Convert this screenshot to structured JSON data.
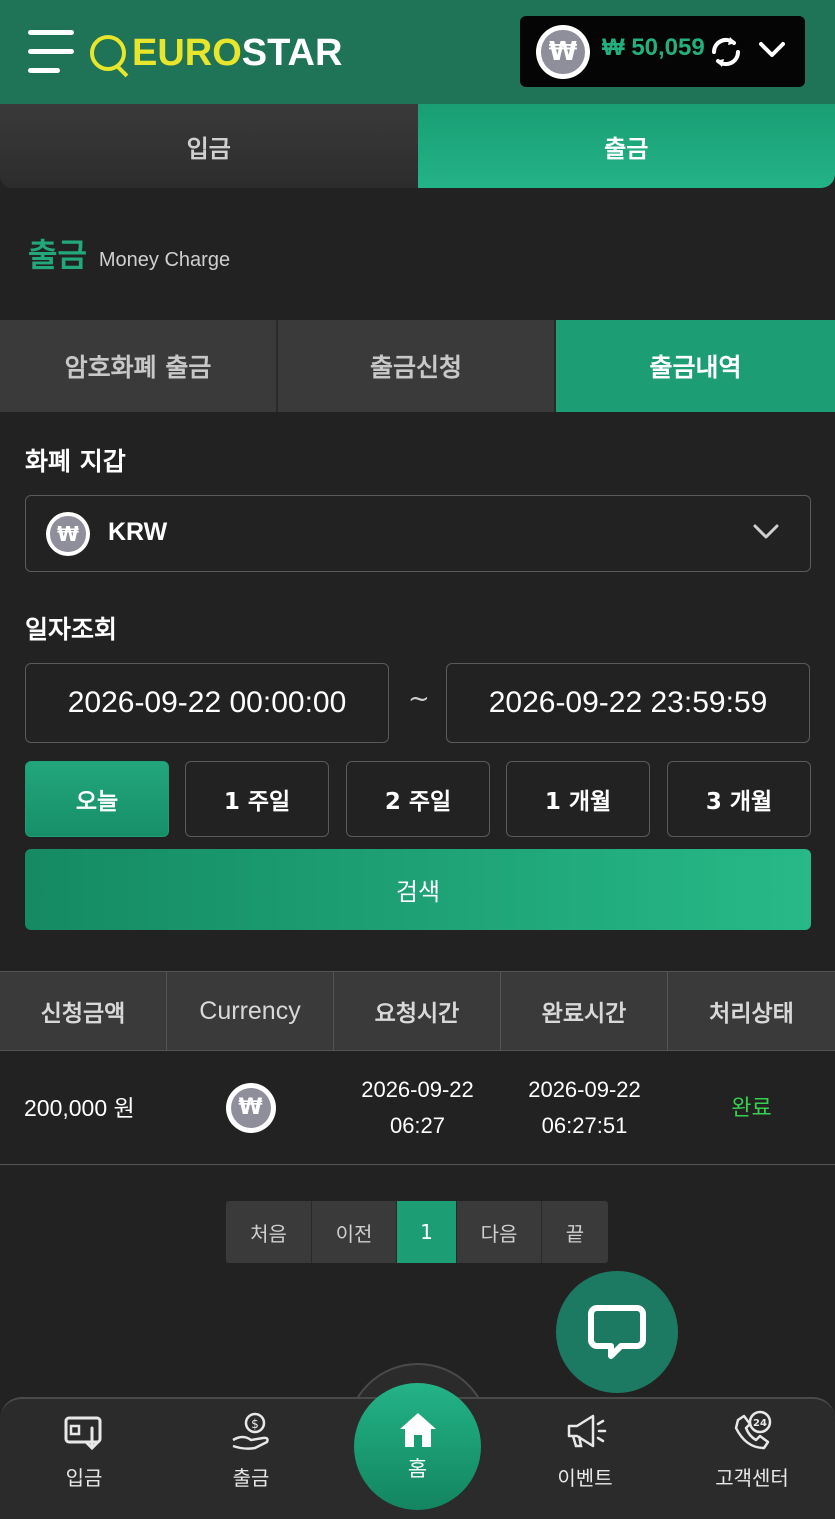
{
  "header": {
    "logo_part1": "EURO",
    "logo_part2": "STAR",
    "currency_symbol": "₩",
    "balance": "₩ 50,059"
  },
  "top_tabs": [
    {
      "label": "입금",
      "active": false
    },
    {
      "label": "출금",
      "active": true
    }
  ],
  "section": {
    "title": "출금",
    "subtitle": "Money Charge"
  },
  "sub_tabs": [
    {
      "label": "암호화폐 출금",
      "active": false
    },
    {
      "label": "출금신청",
      "active": false
    },
    {
      "label": "출금내역",
      "active": true
    }
  ],
  "wallet_select": {
    "label": "화폐 지갑",
    "value": "KRW",
    "icon": "won-coin-icon"
  },
  "date_query": {
    "label": "일자조회",
    "from": "2026-09-22 00:00:00",
    "separator": "~",
    "to": "2026-09-22 23:59:59"
  },
  "quick_ranges": [
    {
      "label": "오늘",
      "active": true
    },
    {
      "label": "1 주일",
      "active": false
    },
    {
      "label": "2 주일",
      "active": false
    },
    {
      "label": "1 개월",
      "active": false
    },
    {
      "label": "3 개월",
      "active": false
    }
  ],
  "search_label": "검색",
  "table": {
    "headers": [
      "신청금액",
      "Currency",
      "요청시간",
      "완료시간",
      "처리상태"
    ],
    "rows": [
      {
        "amount": "200,000 원",
        "currency_icon": "won-coin-icon",
        "request_date": "2026-09-22",
        "request_time": "06:27",
        "complete_date": "2026-09-22",
        "complete_time": "06:27:51",
        "status": "완료"
      }
    ]
  },
  "pagination": [
    "처음",
    "이전",
    "1",
    "다음",
    "끝"
  ],
  "bottom_nav": [
    {
      "label": "입금",
      "icon": "deposit-icon"
    },
    {
      "label": "출금",
      "icon": "withdraw-icon"
    },
    {
      "label": "홈",
      "icon": "home-icon"
    },
    {
      "label": "이벤트",
      "icon": "megaphone-icon"
    },
    {
      "label": "고객센터",
      "icon": "support-24-icon"
    }
  ],
  "colors": {
    "header_bg": "#1f7356",
    "accent": "#1c9d74",
    "logo_yellow": "#e8e62c",
    "status_green": "#36d04f"
  }
}
